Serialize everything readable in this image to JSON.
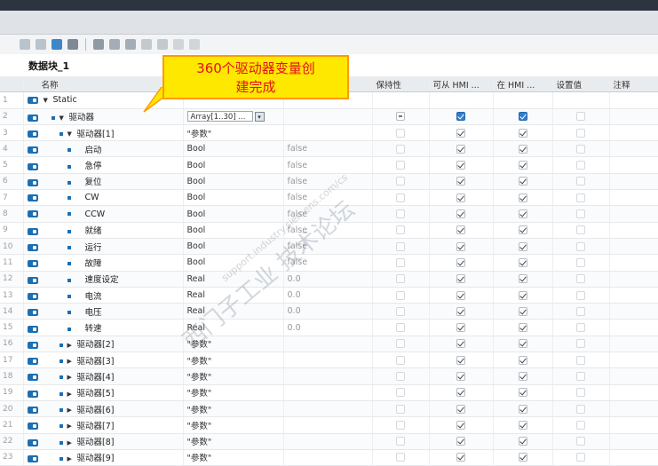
{
  "block_title": "数据块_1",
  "callout": {
    "line1": "360个驱动器变量创",
    "line2": "建完成"
  },
  "columns": {
    "name": "名称",
    "datatype": "",
    "default": "",
    "retain": "保持性",
    "hmi_access": "可从 HMI ...",
    "hmi_visible": "在 HMI ...",
    "setpoint": "设置值",
    "comment": "注释"
  },
  "array_field": "Array[1..30] ...",
  "rows": [
    {
      "n": "1",
      "name": "Static",
      "type": "",
      "default": ""
    },
    {
      "n": "2",
      "name": "驱动器",
      "type": "",
      "default": ""
    },
    {
      "n": "3",
      "name": "驱动器[1]",
      "type": "\"参数\"",
      "default": ""
    },
    {
      "n": "4",
      "name": "启动",
      "type": "Bool",
      "default": "false"
    },
    {
      "n": "5",
      "name": "急停",
      "type": "Bool",
      "default": "false"
    },
    {
      "n": "6",
      "name": "复位",
      "type": "Bool",
      "default": "false"
    },
    {
      "n": "7",
      "name": "CW",
      "type": "Bool",
      "default": "false"
    },
    {
      "n": "8",
      "name": "CCW",
      "type": "Bool",
      "default": "false"
    },
    {
      "n": "9",
      "name": "就绪",
      "type": "Bool",
      "default": "false"
    },
    {
      "n": "10",
      "name": "运行",
      "type": "Bool",
      "default": "false"
    },
    {
      "n": "11",
      "name": "故障",
      "type": "Bool",
      "default": "false"
    },
    {
      "n": "12",
      "name": "速度设定",
      "type": "Real",
      "default": "0.0"
    },
    {
      "n": "13",
      "name": "电流",
      "type": "Real",
      "default": "0.0"
    },
    {
      "n": "14",
      "name": "电压",
      "type": "Real",
      "default": "0.0"
    },
    {
      "n": "15",
      "name": "转速",
      "type": "Real",
      "default": "0.0"
    },
    {
      "n": "16",
      "name": "驱动器[2]",
      "type": "\"参数\"",
      "default": ""
    },
    {
      "n": "17",
      "name": "驱动器[3]",
      "type": "\"参数\"",
      "default": ""
    },
    {
      "n": "18",
      "name": "驱动器[4]",
      "type": "\"参数\"",
      "default": ""
    },
    {
      "n": "19",
      "name": "驱动器[5]",
      "type": "\"参数\"",
      "default": ""
    },
    {
      "n": "20",
      "name": "驱动器[6]",
      "type": "\"参数\"",
      "default": ""
    },
    {
      "n": "21",
      "name": "驱动器[7]",
      "type": "\"参数\"",
      "default": ""
    },
    {
      "n": "22",
      "name": "驱动器[8]",
      "type": "\"参数\"",
      "default": ""
    },
    {
      "n": "23",
      "name": "驱动器[9]",
      "type": "\"参数\"",
      "default": ""
    }
  ],
  "watermark": {
    "main": "西门子工业 技术论坛",
    "url": "support.industry.siemens.com/cs"
  },
  "colors": {
    "callout_bg": "#ffe800",
    "callout_text": "#e3101a",
    "accent": "#1c6fb3"
  }
}
